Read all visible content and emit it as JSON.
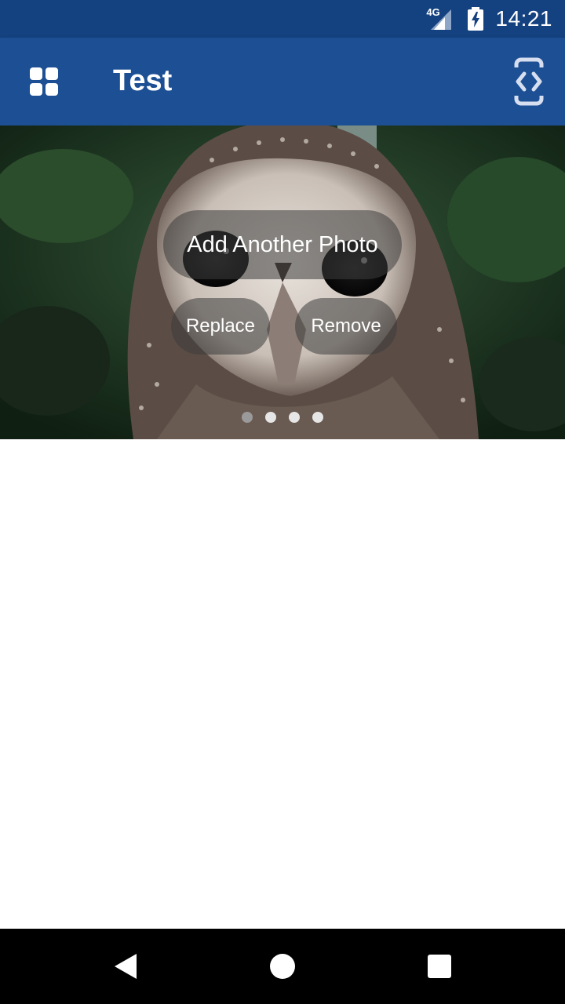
{
  "status_bar": {
    "network": "4G",
    "time": "14:21",
    "icons": [
      "signal-icon",
      "battery-charging-icon"
    ]
  },
  "app_bar": {
    "title": "Test",
    "left_icon": "grid-icon",
    "right_icon": "code-brackets-icon"
  },
  "photo": {
    "subject": "owl",
    "buttons": {
      "add": "Add Another Photo",
      "replace": "Replace",
      "remove": "Remove"
    },
    "pager": {
      "count": 4,
      "active_index": 0
    }
  },
  "nav_bar": {
    "icons": [
      "back-icon",
      "home-icon",
      "recents-icon"
    ]
  },
  "colors": {
    "status_bar": "#14417f",
    "app_bar": "#1c4f93",
    "nav_bar": "#000000"
  }
}
